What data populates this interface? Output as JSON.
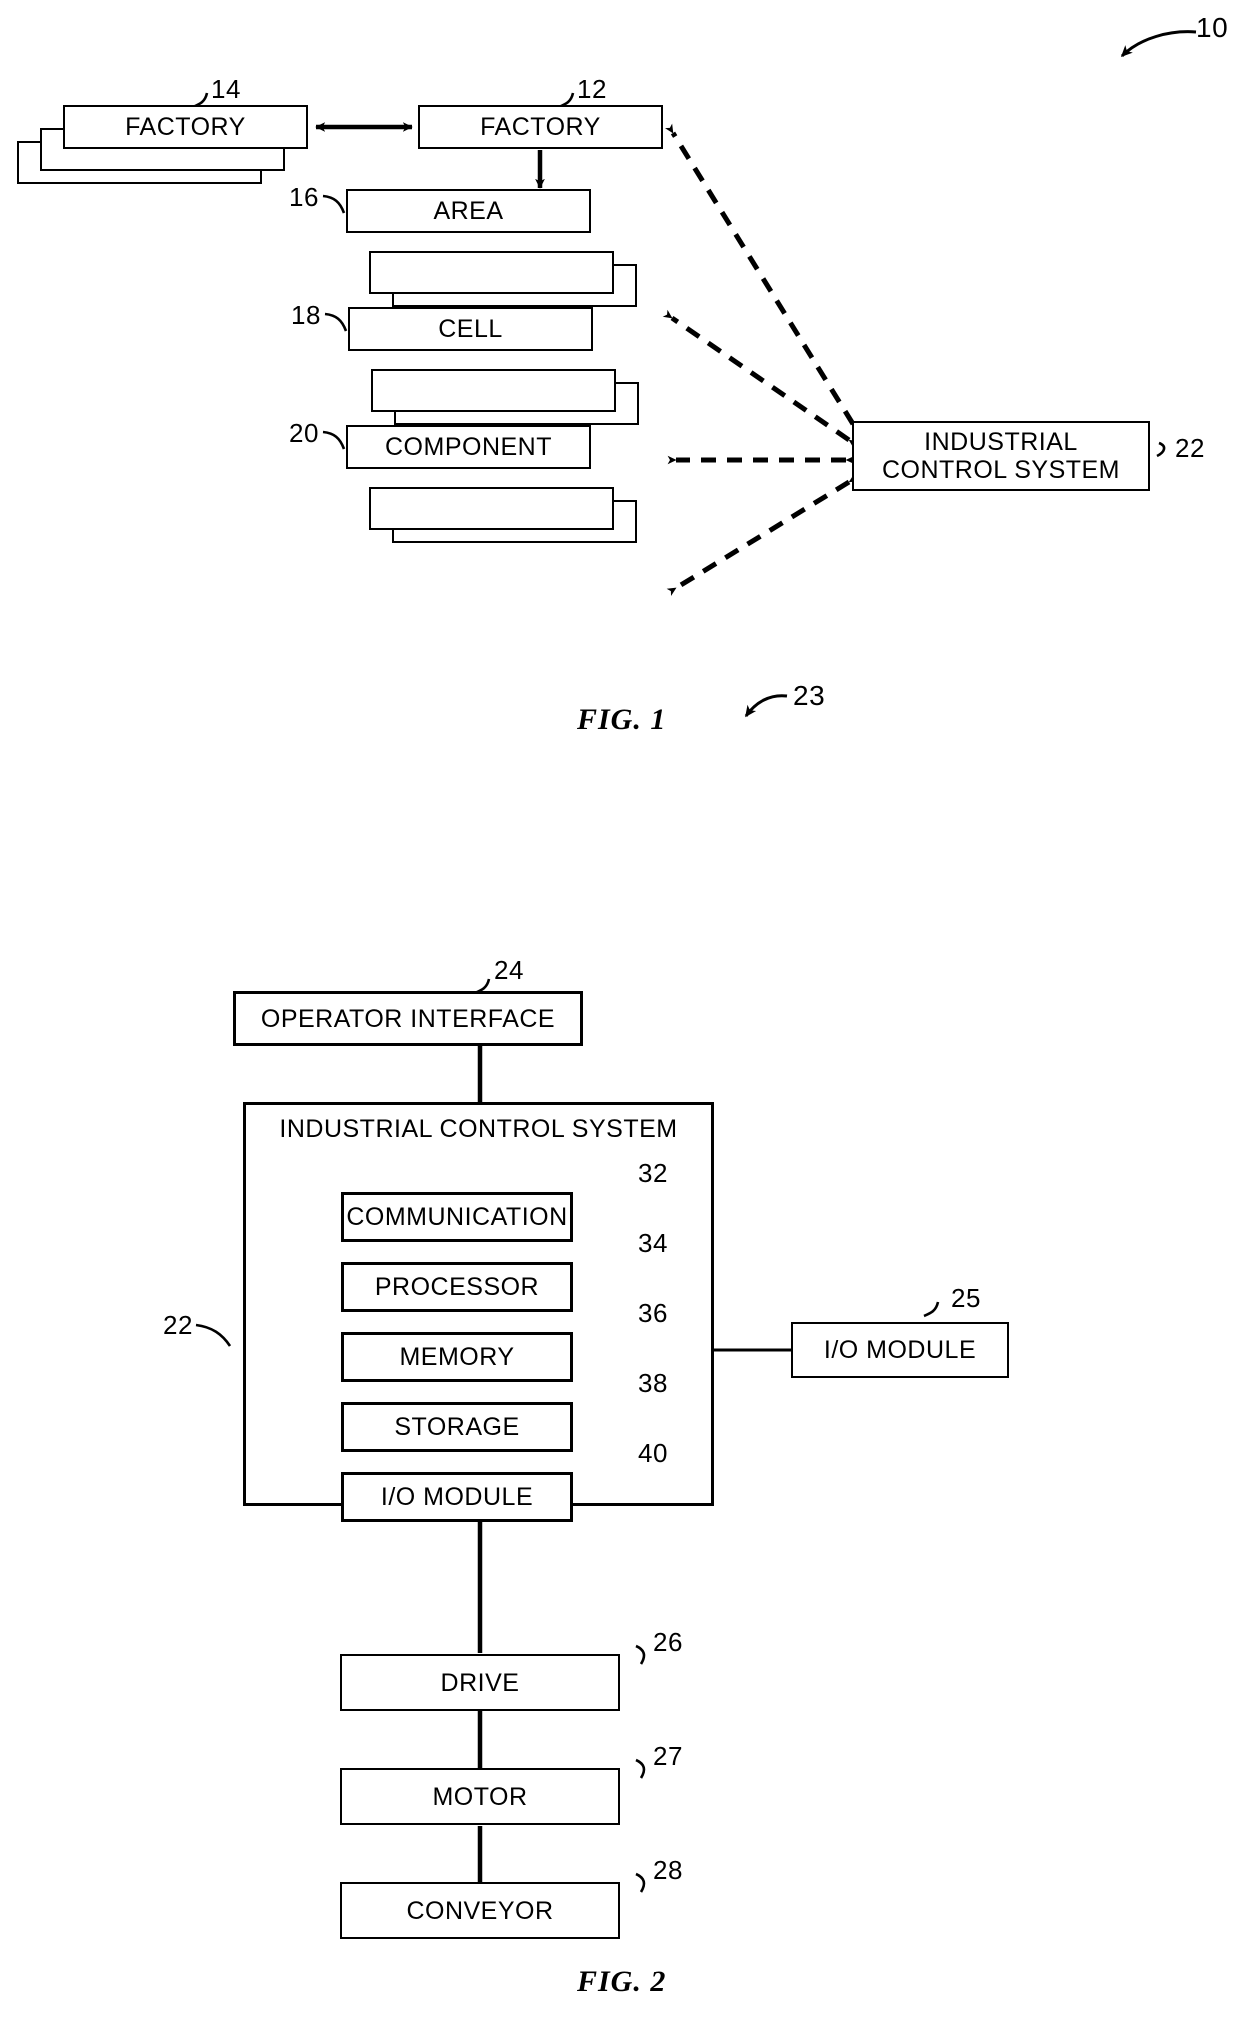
{
  "document": {
    "type": "patent-figure-sheet",
    "figures": [
      {
        "id": "fig1",
        "caption": "FIG. 1",
        "system_ref": "10"
      },
      {
        "id": "fig2",
        "caption": "FIG. 2",
        "system_ref": "23"
      }
    ]
  },
  "fig1": {
    "caption": "FIG. 1",
    "sheet_ref": "10",
    "nodes": {
      "factory_left": {
        "label": "FACTORY",
        "ref": "14",
        "stacked": 3,
        "stack_direction": "down-left"
      },
      "factory_right": {
        "label": "FACTORY",
        "ref": "12",
        "stacked": 1,
        "stack_direction": "none"
      },
      "area": {
        "label": "AREA",
        "ref": "16",
        "stacked": 3,
        "stack_direction": "down-right"
      },
      "cell": {
        "label": "CELL",
        "ref": "18",
        "stacked": 3,
        "stack_direction": "down-right"
      },
      "component": {
        "label": "COMPONENT",
        "ref": "20",
        "stacked": 3,
        "stack_direction": "down-right"
      },
      "ics": {
        "label_line1": "INDUSTRIAL",
        "label_line2": "CONTROL SYSTEM",
        "ref": "22"
      }
    },
    "connections": [
      {
        "from": "factory_left",
        "to": "factory_right",
        "style": "solid",
        "arrow": "both"
      },
      {
        "from": "factory_right",
        "to": "area",
        "style": "solid",
        "arrow": "end"
      },
      {
        "from": "area",
        "to": "cell",
        "style": "solid",
        "arrow": "end"
      },
      {
        "from": "cell",
        "to": "component",
        "style": "solid",
        "arrow": "end"
      },
      {
        "from": "ics",
        "to": "factory_right",
        "style": "dashed",
        "arrow": "both"
      },
      {
        "from": "ics",
        "to": "area",
        "style": "dashed",
        "arrow": "both"
      },
      {
        "from": "ics",
        "to": "cell",
        "style": "dashed",
        "arrow": "both"
      },
      {
        "from": "ics",
        "to": "component",
        "style": "dashed",
        "arrow": "both"
      }
    ]
  },
  "fig2": {
    "caption": "FIG. 2",
    "sheet_ref": "23",
    "operator_interface": {
      "label": "OPERATOR INTERFACE",
      "ref": "24"
    },
    "ics": {
      "label": "INDUSTRIAL CONTROL SYSTEM",
      "ref": "22",
      "modules": [
        {
          "label": "COMMUNICATION",
          "ref": "32"
        },
        {
          "label": "PROCESSOR",
          "ref": "34"
        },
        {
          "label": "MEMORY",
          "ref": "36"
        },
        {
          "label": "STORAGE",
          "ref": "38"
        },
        {
          "label": "I/O MODULE",
          "ref": "40"
        }
      ]
    },
    "external_io": {
      "label": "I/O MODULE",
      "ref": "25"
    },
    "chain": [
      {
        "label": "DRIVE",
        "ref": "26"
      },
      {
        "label": "MOTOR",
        "ref": "27"
      },
      {
        "label": "CONVEYOR",
        "ref": "28"
      }
    ],
    "connections": [
      {
        "from": "operator_interface",
        "to": "ics",
        "style": "solid",
        "arrow": "none"
      },
      {
        "from": "ics",
        "to": "external_io",
        "style": "solid",
        "arrow": "none"
      },
      {
        "from": "ics",
        "to": "DRIVE",
        "style": "solid",
        "arrow": "none"
      },
      {
        "from": "DRIVE",
        "to": "MOTOR",
        "style": "solid",
        "arrow": "none"
      },
      {
        "from": "MOTOR",
        "to": "CONVEYOR",
        "style": "solid",
        "arrow": "none"
      }
    ]
  },
  "colors": {
    "ink": "#000000",
    "paper": "#ffffff"
  }
}
